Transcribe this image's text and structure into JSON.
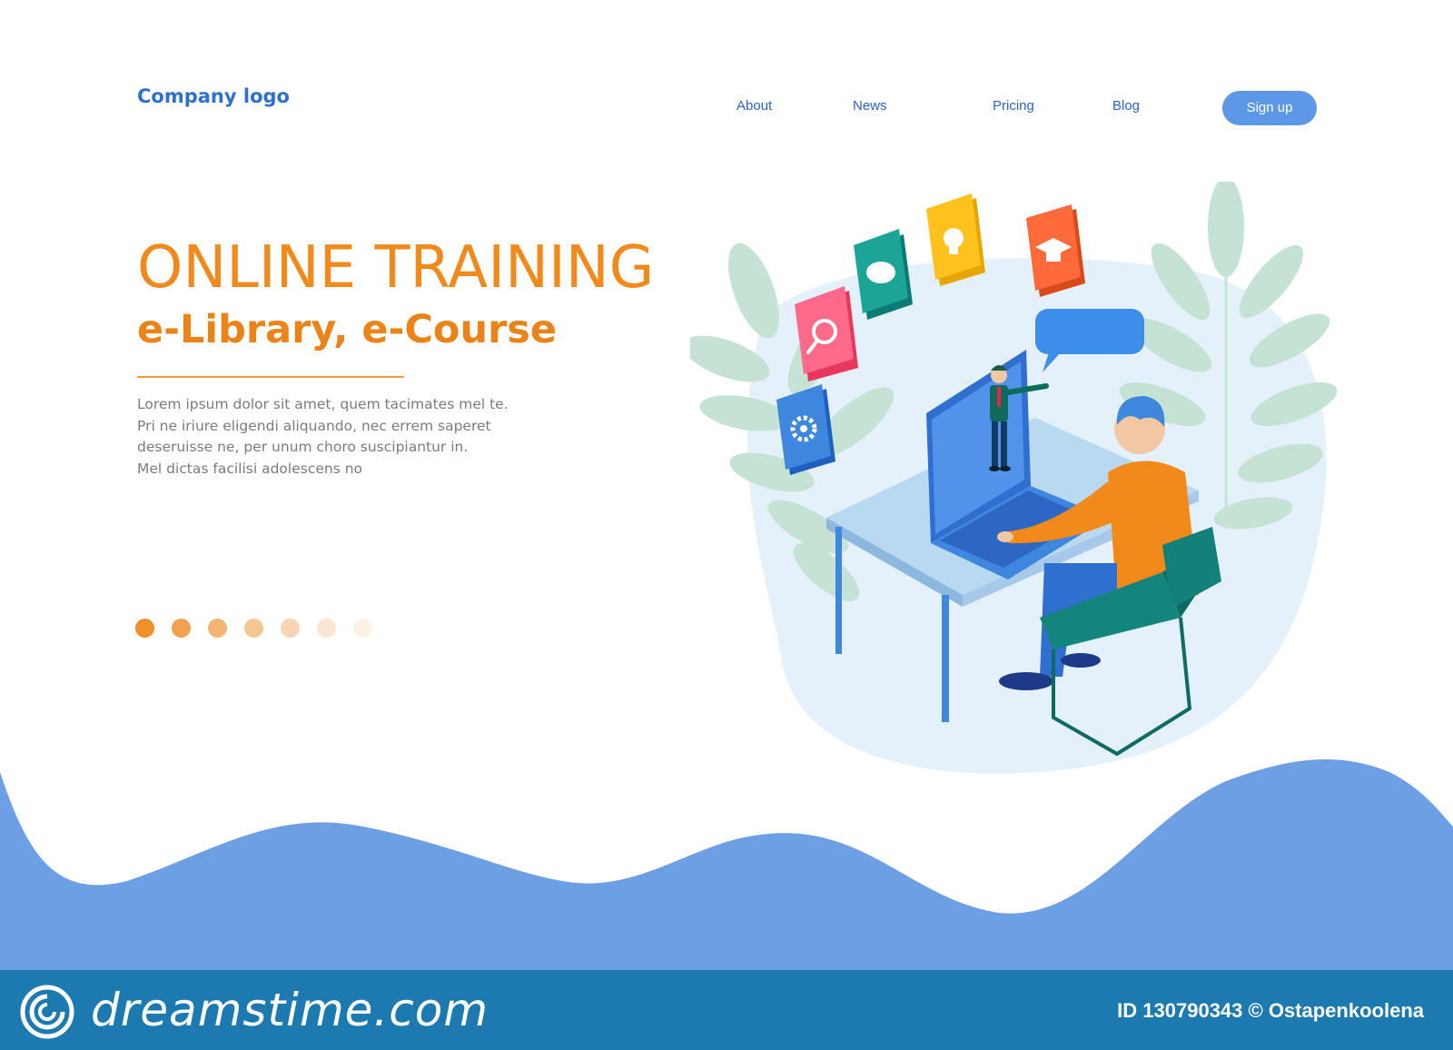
{
  "header": {
    "logo": "Company logo",
    "nav": [
      {
        "label": "About"
      },
      {
        "label": "News"
      },
      {
        "label": "Pricing"
      },
      {
        "label": "Blog"
      }
    ],
    "signup_label": "Sign up"
  },
  "hero": {
    "title": "ONLINE TRAINING",
    "subtitle": "e-Library, e-Course",
    "body_lines": [
      "Lorem ipsum dolor sit amet, quem tacimates mel te.",
      "Pri ne iriure eligendi aliquando, nec errem saperet",
      "deseruisse ne, per unum choro suscipiantur in.",
      "Mel dictas facilisi adolescens no"
    ]
  },
  "pagination": {
    "active_index": 0,
    "dot_colors": [
      "#f0902a",
      "#f2a24f",
      "#f4b473",
      "#f6c594",
      "#f8d6b5",
      "#fae6d3",
      "#fcf1e7"
    ]
  },
  "illustration": {
    "icons": [
      "search-icon",
      "chat-icon",
      "lightbulb-icon",
      "graduation-cap-icon",
      "gear-icon"
    ]
  },
  "footer": {
    "brand": "dreamstime.com",
    "credit": "ID 130790343 © Ostapenkoolena"
  },
  "colors": {
    "accent_orange": "#f08a1c",
    "accent_blue": "#5e97e6",
    "footer_bar": "#1d7ab1",
    "wave": "#6d9fe4"
  }
}
